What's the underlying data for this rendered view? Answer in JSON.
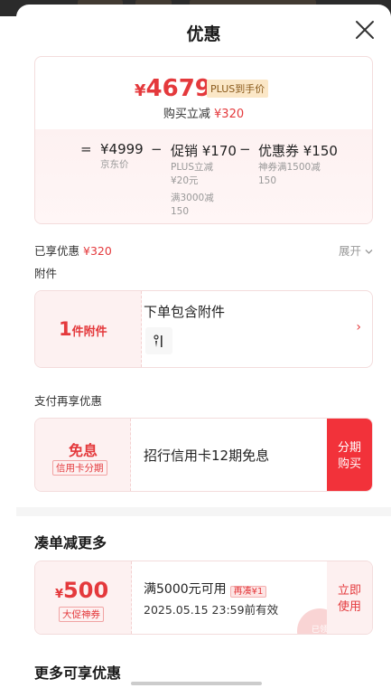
{
  "header": {
    "title": "优惠"
  },
  "price_card": {
    "currency": "¥",
    "final_price": "4679",
    "plus_tag": "PLUS到手价",
    "reduce_label": "购买立减",
    "reduce_amount": "¥320",
    "breakdown": {
      "eq": "=",
      "jd_price": "¥4999",
      "jd_label": "京东价",
      "minus1": "−",
      "promo": "促销 ¥170",
      "promo_sub1": "PLUS立减",
      "promo_sub2": "¥20元",
      "promo_sub3": "满3000减",
      "promo_sub4": "150",
      "minus2": "−",
      "coupon": "优惠券 ¥150",
      "coupon_sub1": "神券满1500减",
      "coupon_sub2": "150"
    }
  },
  "enjoy": {
    "label": "已享优惠",
    "amount": "¥320",
    "expand": "展开"
  },
  "accessory": {
    "section": "附件",
    "count": "1",
    "unit": "件附件",
    "title": "下单包含附件",
    "arrow": "›"
  },
  "payment": {
    "section": "支付再享优惠",
    "title": "免息",
    "tag": "信用卡分期",
    "desc": "招行信用卡12期免息",
    "button_line1": "分期",
    "button_line2": "购买"
  },
  "coupon_section": {
    "title": "凑单减更多",
    "symbol": "¥",
    "value": "500",
    "tag": "大促神券",
    "condition": "满5000元可用",
    "again": "再凑¥1",
    "date": "2025.05.15 23:59前有效",
    "button_line1": "立即",
    "button_line2": "使用",
    "stamp": "已领"
  },
  "more": {
    "title": "更多可享优惠"
  },
  "colors": {
    "accent": "#e4393c",
    "button_red": "#f2323a",
    "card_bg": "#fdf1f1"
  }
}
